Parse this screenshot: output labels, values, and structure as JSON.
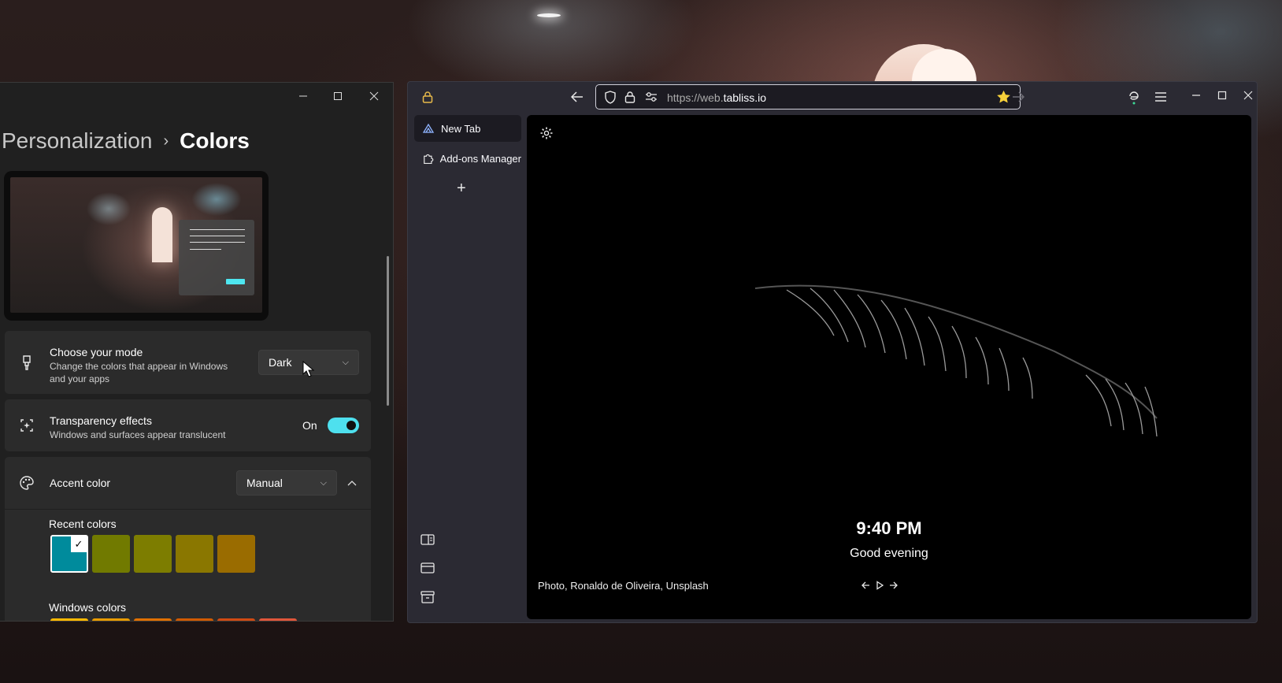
{
  "settings": {
    "breadcrumb_parent": "Personalization",
    "breadcrumb_sep": "›",
    "page_title": "Colors",
    "mode": {
      "title": "Choose your mode",
      "subtitle_line1": "Change the colors that appear in Windows",
      "subtitle_line2": "and your apps",
      "value": "Dark"
    },
    "transparency": {
      "title": "Transparency effects",
      "subtitle": "Windows and surfaces appear translucent",
      "state_label": "On",
      "enabled": true
    },
    "accent": {
      "title": "Accent color",
      "value": "Manual"
    },
    "recent_colors_label": "Recent colors",
    "recent_colors": [
      "#008b9c",
      "#717a00",
      "#7d7d00",
      "#8a7700",
      "#9a6c00"
    ],
    "windows_colors_label": "Windows colors",
    "windows_colors": [
      "#ffb900",
      "#e89b00",
      "#e07000",
      "#d05a00",
      "#d04a12",
      "#e0563a"
    ]
  },
  "browser": {
    "url_prefix": "https://web.",
    "url_domain": "tabliss.io",
    "tabs": [
      {
        "label": "New Tab",
        "icon": "tabliss-icon"
      },
      {
        "label": "Add-ons Manager",
        "icon": "puzzle-icon"
      }
    ],
    "new_tab_symbol": "+"
  },
  "page": {
    "time": "9:40 PM",
    "greeting": "Good evening",
    "credit": "Photo, Ronaldo de Oliveira, Unsplash"
  },
  "colors": {
    "accent": "#4ee0ee",
    "settings_bg": "#202020",
    "browser_bg": "#2b2a33"
  }
}
